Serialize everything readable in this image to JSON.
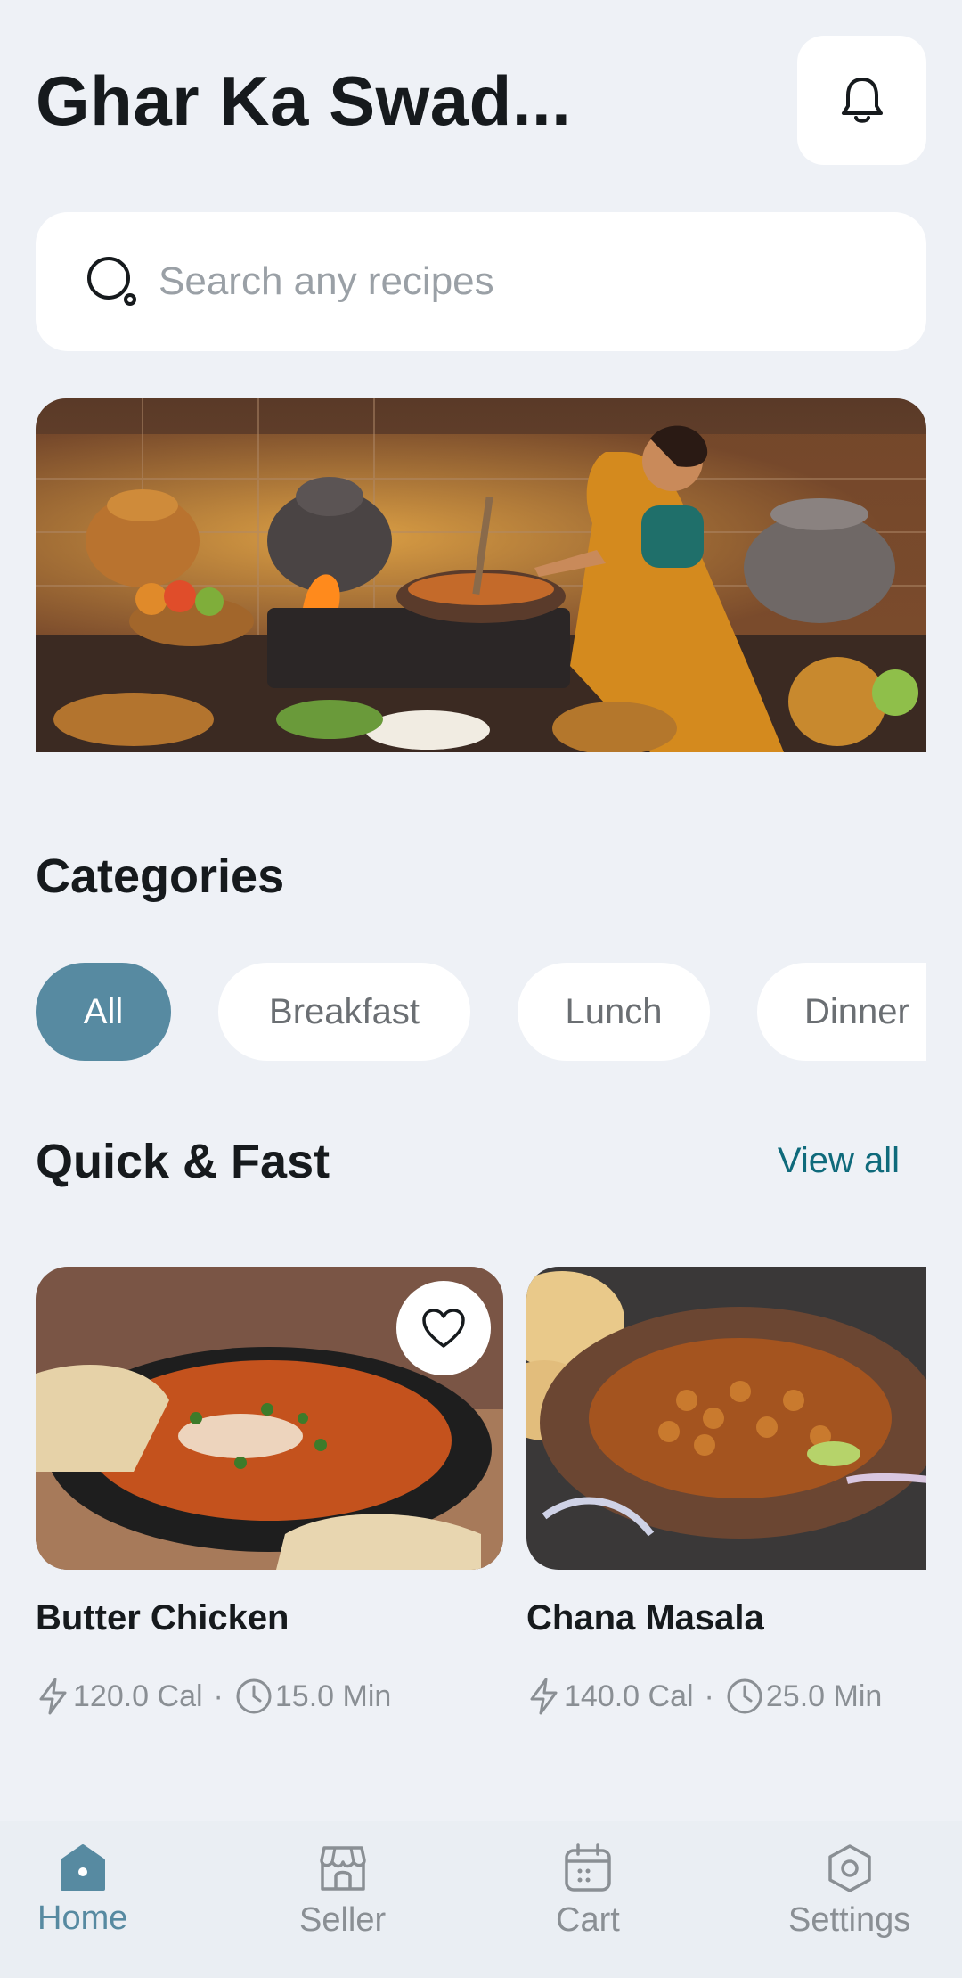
{
  "header": {
    "title": "Ghar Ka Swad..."
  },
  "search": {
    "placeholder": "Search any recipes"
  },
  "categories": {
    "title": "Categories",
    "items": [
      {
        "label": "All",
        "active": true
      },
      {
        "label": "Breakfast",
        "active": false
      },
      {
        "label": "Lunch",
        "active": false
      },
      {
        "label": "Dinner",
        "active": false
      }
    ]
  },
  "quick": {
    "title": "Quick & Fast",
    "view_all": "View all",
    "cards": [
      {
        "name": "Butter Chicken",
        "calories": "120.0 Cal",
        "time": "15.0 Min"
      },
      {
        "name": "Chana Masala",
        "calories": "140.0 Cal",
        "time": "25.0 Min"
      }
    ],
    "separator": "·"
  },
  "nav": {
    "items": [
      {
        "label": "Home",
        "icon": "home-icon",
        "active": true
      },
      {
        "label": "Seller",
        "icon": "store-icon",
        "active": false
      },
      {
        "label": "Cart",
        "icon": "calendar-icon",
        "active": false
      },
      {
        "label": "Settings",
        "icon": "settings-icon",
        "active": false
      }
    ]
  },
  "colors": {
    "accent": "#578aa1",
    "link": "#0f6a7b",
    "background": "#eef1f6"
  }
}
